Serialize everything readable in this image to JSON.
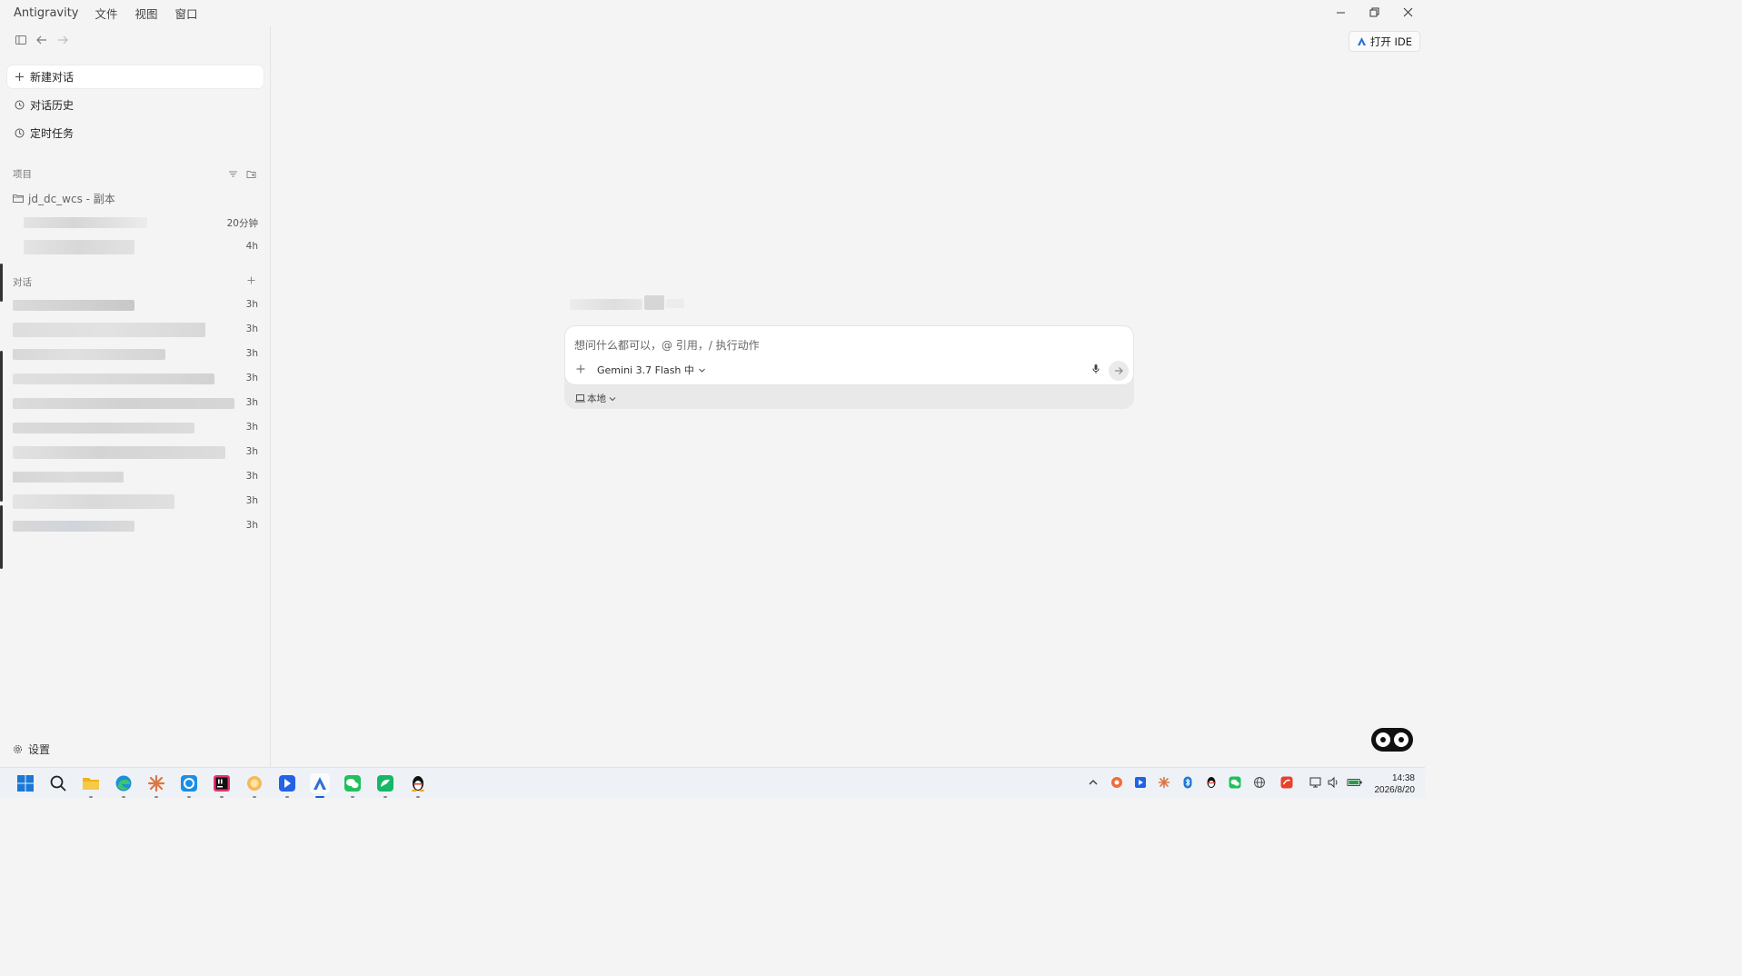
{
  "titlebar": {
    "app_name": "Antigravity",
    "menu": [
      "文件",
      "视图",
      "窗口"
    ]
  },
  "sidebar": {
    "new_chat": "新建对话",
    "history": "对话历史",
    "scheduled": "定时任务",
    "projects_title": "项目",
    "project_name": "jd_dc_wcs - 副本",
    "project_items": [
      {
        "time": "20分钟"
      },
      {
        "time": "4h"
      }
    ],
    "chats_title": "对话",
    "chats": [
      {
        "time": "3h"
      },
      {
        "time": "3h"
      },
      {
        "time": "3h"
      },
      {
        "time": "3h"
      },
      {
        "time": "3h"
      },
      {
        "time": "3h"
      },
      {
        "time": "3h"
      },
      {
        "time": "3h"
      },
      {
        "time": "3h"
      },
      {
        "time": "3h"
      }
    ],
    "settings": "设置"
  },
  "main": {
    "open_ide": "打开 IDE",
    "composer": {
      "placeholder": "想问什么都可以，@ 引用，/ 执行动作",
      "model": "Gemini 3.7 Flash 中",
      "mode": "本地"
    }
  },
  "taskbar": {
    "time": "14:38",
    "date": "2026/8/20"
  },
  "colors": {
    "background": "#f4f4f4",
    "panel": "#ffffff",
    "accent": "#0a64d8",
    "text": "#222222"
  }
}
